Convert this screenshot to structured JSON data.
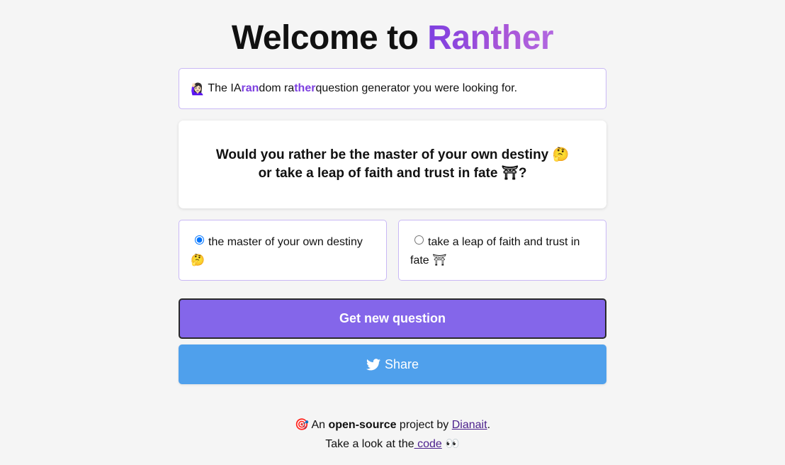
{
  "header": {
    "title_prefix": "Welcome to ",
    "title_brand": "Ranther"
  },
  "tagline": {
    "icon": "🙋🏻‍♀️",
    "text_1": "The IA ",
    "hl_1": "ran",
    "text_2": "dom ra",
    "hl_2": "ther",
    "text_3": " question generator you were looking for."
  },
  "question": {
    "line_1": "Would you rather be the master of your own destiny 🤔",
    "line_2": "or take a leap of faith and trust in fate ⛩?"
  },
  "options": [
    {
      "label": "the master of your own destiny 🤔",
      "selected": true
    },
    {
      "label": "take a leap of faith and trust in fate ⛩",
      "selected": false
    }
  ],
  "buttons": {
    "new_question": "Get new question",
    "share": "Share"
  },
  "footer": {
    "icon": "🎯",
    "text_1": " An ",
    "strong": "open-source",
    "text_2": " project by ",
    "author_link": "Dianait",
    "text_3": ".",
    "line2_text": "Take a look at the",
    "code_link": " code",
    "eyes": " 👀"
  },
  "colors": {
    "brand": "#7e3fe0",
    "primary_button": "#8466ea",
    "share_button": "#4fa0ec",
    "border": "#c9b8f5"
  }
}
